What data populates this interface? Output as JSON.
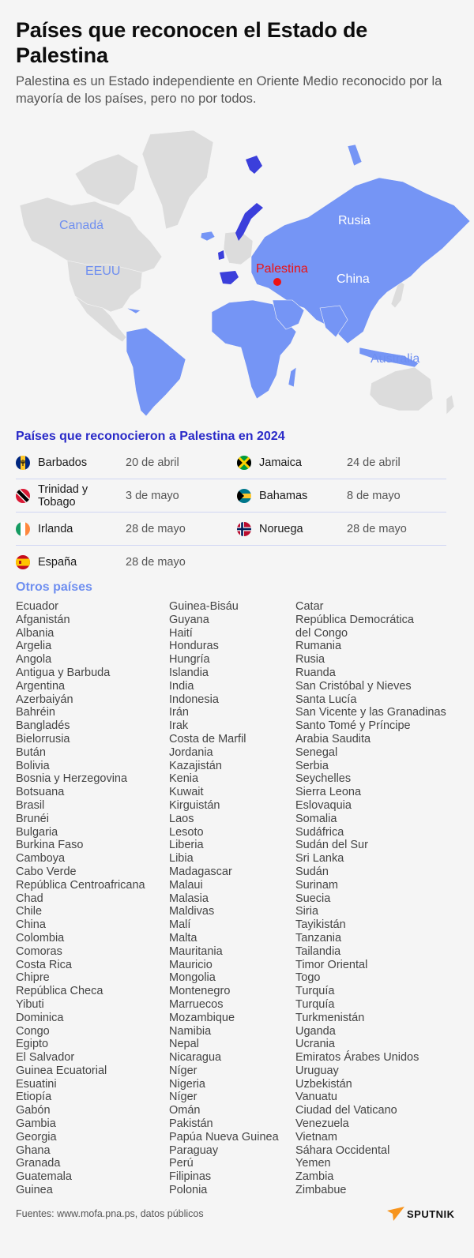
{
  "header": {
    "title": "Países que reconocen el Estado de Palestina",
    "subtitle": "Palestina es un Estado independiente en Oriente Medio reconocido por la mayoría de los países, pero no por todos."
  },
  "map": {
    "labels": {
      "canada": "Canadá",
      "usa": "EEUU",
      "russia": "Rusia",
      "china": "China",
      "palestine": "Palestina",
      "australia": "Australia"
    },
    "legend_colors": {
      "recognizes": "#7595f5",
      "recognized_2024": "#3b3fdb",
      "not_recognizes": "#dcdcdc",
      "palestine_marker": "#ee1111"
    }
  },
  "recognized_2024": {
    "title": "Países que reconocieron a Palestina en 2024",
    "rows": [
      [
        {
          "country": "Barbados",
          "date": "20 de abril",
          "flag": "barbados-flag"
        },
        {
          "country": "Jamaica",
          "date": "24 de abril",
          "flag": "jamaica-flag"
        }
      ],
      [
        {
          "country": "Trinidad y Tobago",
          "date": "3 de mayo",
          "flag": "trinidad-tobago-flag"
        },
        {
          "country": "Bahamas",
          "date": "8 de mayo",
          "flag": "bahamas-flag"
        }
      ],
      [
        {
          "country": "Irlanda",
          "date": "28 de mayo",
          "flag": "ireland-flag"
        },
        {
          "country": "Noruega",
          "date": "28 de mayo",
          "flag": "norway-flag"
        }
      ],
      [
        {
          "country": "España",
          "date": "28 de mayo",
          "flag": "spain-flag"
        }
      ]
    ]
  },
  "other_countries": {
    "title": "Otros países",
    "columns": [
      [
        "Ecuador",
        "Afganistán",
        "Albania",
        "Argelia",
        "Angola",
        "Antigua y Barbuda",
        "Argentina",
        "Azerbaiyán",
        "Bahréin",
        "Bangladés",
        "Bielorrusia",
        "Bután",
        "Bolivia",
        "Bosnia y Herzegovina",
        "Botsuana",
        "Brasil",
        "Brunéi",
        "Bulgaria",
        "Burkina Faso",
        "Camboya",
        "Cabo Verde",
        "República Centroafricana",
        "Chad",
        "Chile",
        "China",
        "Colombia",
        "Comoras",
        "Costa Rica",
        "Chipre",
        "República Checa",
        "Yibuti",
        "Dominica",
        "Congo",
        "Egipto",
        "El Salvador",
        "Guinea Ecuatorial",
        "Esuatini",
        "Etiopía",
        "Gabón",
        "Gambia",
        "Georgia",
        "Ghana",
        "Granada",
        "Guatemala",
        "Guinea"
      ],
      [
        "Guinea-Bisáu",
        "Guyana",
        "Haití",
        "Honduras",
        "Hungría",
        "Islandia",
        "India",
        "Indonesia",
        "Irán",
        "Irak",
        "Costa de Marfil",
        "Jordania",
        "Kazajistán",
        "Kenia",
        "Kuwait",
        "Kirguistán",
        "Laos",
        "Lesoto",
        "Liberia",
        "Libia",
        "Madagascar",
        "Malaui",
        "Malasia",
        "Maldivas",
        "Malí",
        "Malta",
        "Mauritania",
        "Mauricio",
        "Mongolia",
        "Montenegro",
        "Marruecos",
        "Mozambique",
        "Namibia",
        "Nepal",
        "Nicaragua",
        "Níger",
        "Nigeria",
        "Níger",
        "Omán",
        "Pakistán",
        "Papúa Nueva Guinea",
        "Paraguay",
        "Perú",
        "Filipinas",
        "Polonia"
      ],
      [
        "Catar",
        "República Democrática",
        "del Congo",
        "Rumania",
        "Rusia",
        "Ruanda",
        "San Cristóbal y Nieves",
        "Santa Lucía",
        "San Vicente y las Granadinas",
        "Santo Tomé y Príncipe",
        "Arabia Saudita",
        "Senegal",
        "Serbia",
        "Seychelles",
        "Sierra Leona",
        "Eslovaquia",
        "Somalia",
        "Sudáfrica",
        "Sudán del Sur",
        "Sri Lanka",
        "Sudán",
        "Surinam",
        "Suecia",
        "Siria",
        "Tayikistán",
        "Tanzania",
        "Tailandia",
        "Timor Oriental",
        "Togo",
        "Turquía",
        "Turquía",
        "Turkmenistán",
        "Uganda",
        "Ucrania",
        "Emiratos Árabes Unidos",
        "Uruguay",
        "Uzbekistán",
        "Vanuatu",
        "Ciudad del Vaticano",
        "Venezuela",
        "Vietnam",
        "Sáhara Occidental",
        "Yemen",
        "Zambia",
        "Zimbabue"
      ]
    ]
  },
  "footer": {
    "sources": "Fuentes: www.mofa.pna.ps, datos públicos",
    "brand": "SPUTNIK"
  }
}
